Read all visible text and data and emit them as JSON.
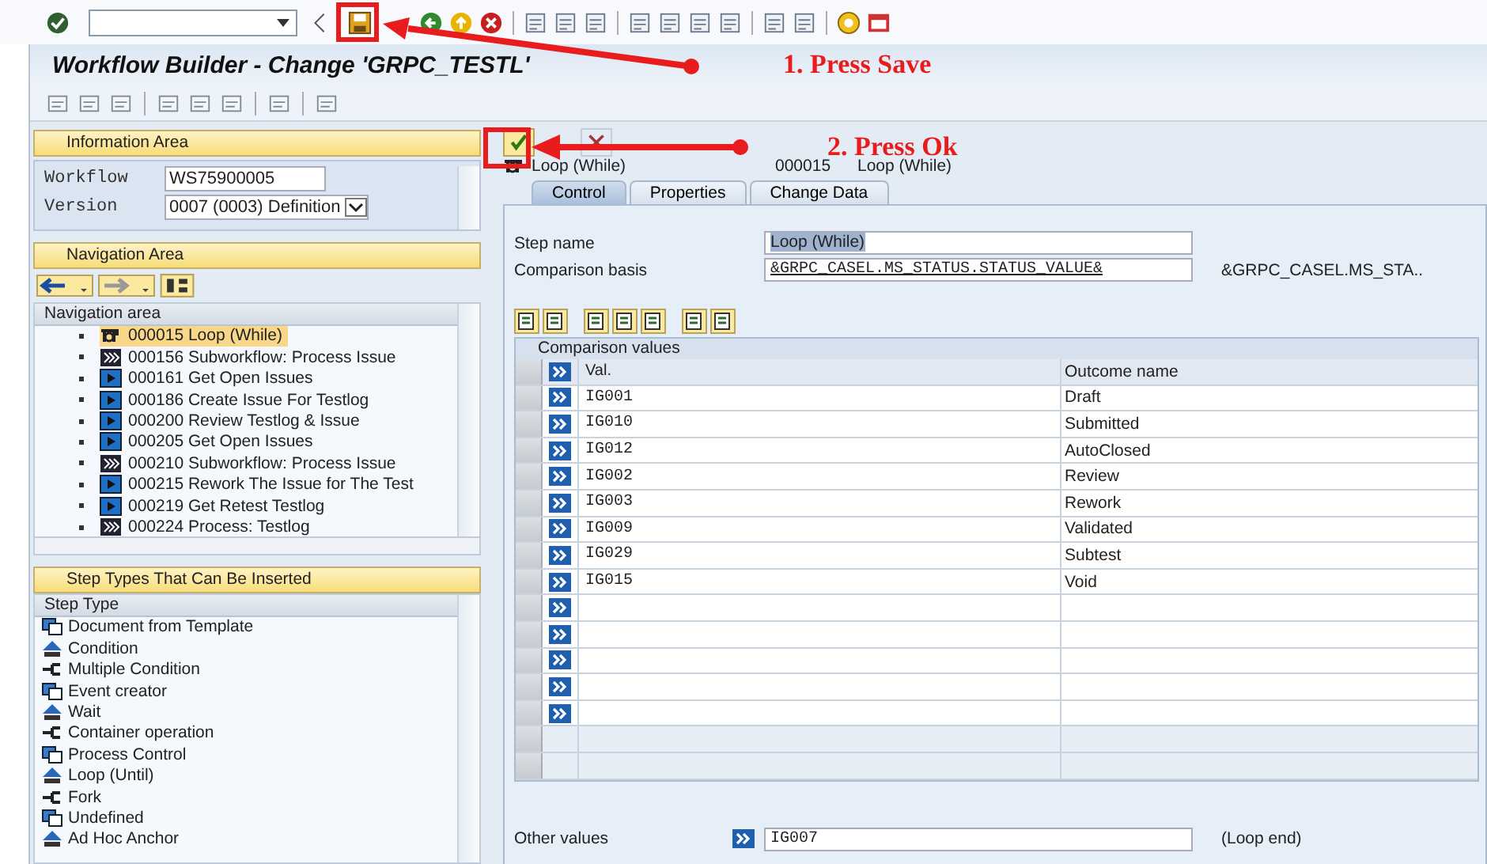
{
  "window": {
    "title": "Workflow Builder - Change 'GRPC_TESTL'"
  },
  "annotations": [
    {
      "text": "1. Press Save"
    },
    {
      "text": "2. Press Ok"
    }
  ],
  "information_area": {
    "title": "Information Area",
    "fields": [
      {
        "label": "Workflow",
        "value": "WS75900005",
        "kind": "text"
      },
      {
        "label": "Version",
        "value": "0007 (0003) Definition",
        "kind": "dropdown"
      }
    ]
  },
  "navigation_area": {
    "title": "Navigation Area",
    "tree_header": "Navigation area",
    "items": [
      {
        "label": "000015 Loop (While)",
        "kind": "loop",
        "selected": true
      },
      {
        "label": "000156 Subworkflow: Process Issue",
        "kind": "subworkflow",
        "selected": false
      },
      {
        "label": "000161 Get Open Issues",
        "kind": "activity",
        "selected": false
      },
      {
        "label": "000186 Create Issue For Testlog",
        "kind": "activity",
        "selected": false
      },
      {
        "label": "000200 Review Testlog & Issue",
        "kind": "activity",
        "selected": false
      },
      {
        "label": "000205 Get Open Issues",
        "kind": "activity",
        "selected": false
      },
      {
        "label": "000210 Subworkflow: Process Issue",
        "kind": "subworkflow",
        "selected": false
      },
      {
        "label": "000215 Rework The Issue for The Test",
        "kind": "activity",
        "selected": false
      },
      {
        "label": "000219 Get Retest Testlog",
        "kind": "activity",
        "selected": false
      },
      {
        "label": "000224 Process: Testlog",
        "kind": "subworkflow",
        "selected": false
      }
    ]
  },
  "step_types": {
    "title": "Step Types That Can Be Inserted",
    "column": "Step Type",
    "items": [
      "Document from Template",
      "Condition",
      "Multiple Condition",
      "Event creator",
      "Wait",
      "Container operation",
      "Process Control",
      "Loop (Until)",
      "Fork",
      "Undefined",
      "Ad Hoc Anchor"
    ]
  },
  "step": {
    "title": "Loop (While)",
    "number": "000015",
    "type": "Loop (While)"
  },
  "tabs": [
    {
      "label": "Control",
      "selected": true
    },
    {
      "label": "Properties",
      "selected": false
    },
    {
      "label": "Change Data",
      "selected": false
    }
  ],
  "form": {
    "step_name": {
      "label": "Step name",
      "value": "Loop (While)"
    },
    "comparison_basis": {
      "label": "Comparison basis",
      "value": "&GRPC_CASEL.MS_STATUS.STATUS_VALUE&",
      "description": "&GRPC_CASEL.MS_STA.."
    }
  },
  "comparison_values": {
    "title": "Comparison values",
    "columns": [
      "Val.",
      "Outcome name"
    ],
    "rows": [
      {
        "kind": "entry",
        "value": "IG001",
        "outcome": "Draft"
      },
      {
        "kind": "entry",
        "value": "IG010",
        "outcome": "Submitted"
      },
      {
        "kind": "entry",
        "value": "IG012",
        "outcome": "AutoClosed"
      },
      {
        "kind": "entry",
        "value": "IG002",
        "outcome": "Review"
      },
      {
        "kind": "entry",
        "value": "IG003",
        "outcome": "Rework"
      },
      {
        "kind": "entry",
        "value": "IG009",
        "outcome": "Validated"
      },
      {
        "kind": "entry",
        "value": "IG029",
        "outcome": "Subtest"
      },
      {
        "kind": "entry",
        "value": "IG015",
        "outcome": "Void"
      },
      {
        "kind": "blank"
      },
      {
        "kind": "blank"
      },
      {
        "kind": "blank"
      },
      {
        "kind": "blank"
      },
      {
        "kind": "blank"
      },
      {
        "kind": "filler"
      },
      {
        "kind": "filler"
      }
    ]
  },
  "other_values": {
    "label": "Other values",
    "value": "IG007",
    "note": "(Loop end)"
  }
}
